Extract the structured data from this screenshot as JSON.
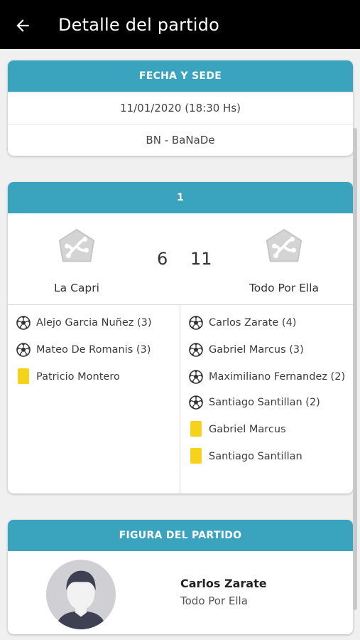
{
  "appbar": {
    "title": "Detalle del partido",
    "back_icon": "arrow-left-icon"
  },
  "venue": {
    "header": "FECHA Y SEDE",
    "datetime": "11/01/2020 (18:30 Hs)",
    "place": "BN - BaNaDe"
  },
  "match": {
    "header": "1",
    "home": {
      "name": "La Capri",
      "score": "6"
    },
    "away": {
      "name": "Todo Por Ella",
      "score": "11"
    },
    "home_events": [
      {
        "type": "goal",
        "icon": "soccer-ball-icon",
        "text": "Alejo Garcia Nuñez (3)"
      },
      {
        "type": "goal",
        "icon": "soccer-ball-icon",
        "text": "Mateo De Romanis (3)"
      },
      {
        "type": "yellow",
        "icon": "yellow-card-icon",
        "text": "Patricio Montero"
      }
    ],
    "away_events": [
      {
        "type": "goal",
        "icon": "soccer-ball-icon",
        "text": "Carlos Zarate (4)"
      },
      {
        "type": "goal",
        "icon": "soccer-ball-icon",
        "text": "Gabriel Marcus (3)"
      },
      {
        "type": "goal",
        "icon": "soccer-ball-icon",
        "text": "Maximiliano Fernandez (2)"
      },
      {
        "type": "goal",
        "icon": "soccer-ball-icon",
        "text": "Santiago Santillan (2)"
      },
      {
        "type": "yellow",
        "icon": "yellow-card-icon",
        "text": "Gabriel Marcus"
      },
      {
        "type": "yellow",
        "icon": "yellow-card-icon",
        "text": "Santiago Santillan"
      }
    ]
  },
  "figure": {
    "header": "FIGURA DEL PARTIDO",
    "name": "Carlos Zarate",
    "team": "Todo Por Ella"
  },
  "colors": {
    "header_bg": "#3aa3bd",
    "yellow_card": "#f7d21a",
    "appbar_bg": "#000000"
  }
}
